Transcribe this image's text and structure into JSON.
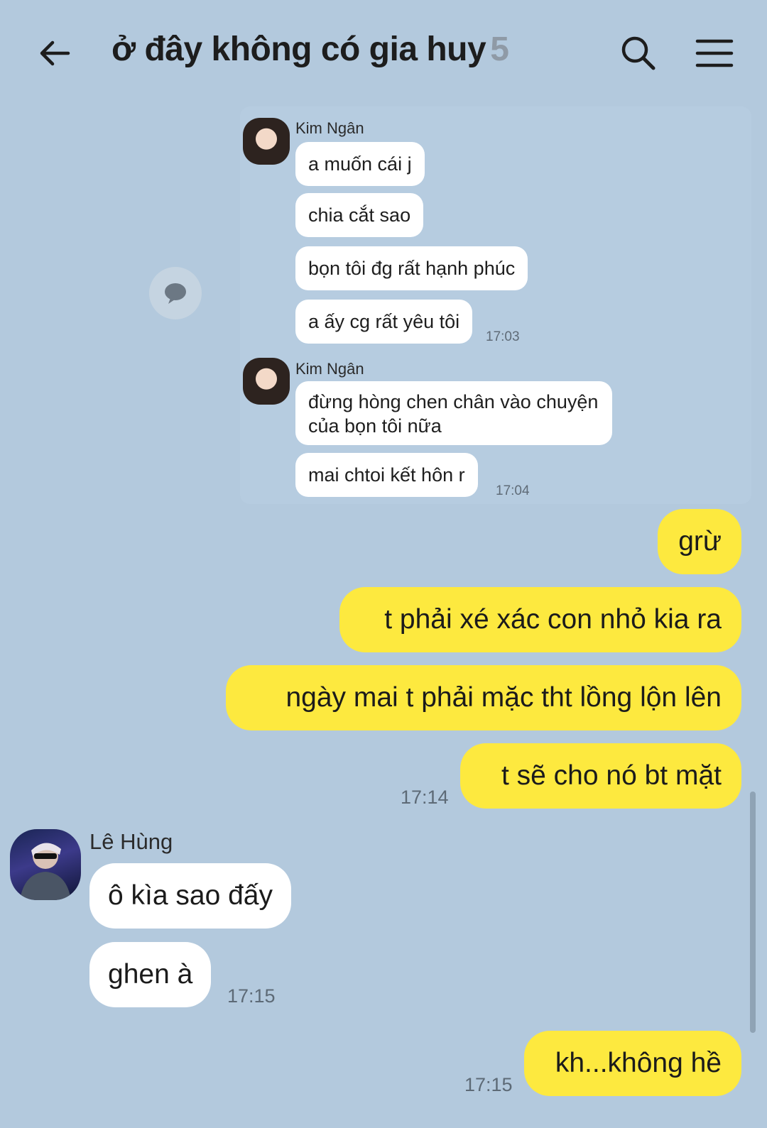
{
  "header": {
    "title": "ở đây không có gia huy",
    "member_count": "5"
  },
  "shared_screenshot": {
    "groups": [
      {
        "sender": "Kim Ngân",
        "messages": [
          "a muốn cái j",
          "chia cắt sao",
          "bọn tôi đg rất hạnh phúc",
          "a ấy cg rất yêu tôi"
        ],
        "time": "17:03"
      },
      {
        "sender": "Kim Ngân",
        "messages": [
          "đừng hòng chen chân vào chuyện của bọn tôi nữa",
          "mai chtoi kết hôn r"
        ],
        "time": "17:04"
      }
    ]
  },
  "my_messages_1": {
    "messages": [
      "grừ",
      "t phải xé xác con nhỏ kia ra",
      "ngày mai t phải mặc tht lồng lộn lên",
      "t sẽ cho nó bt mặt"
    ],
    "time": "17:14"
  },
  "other_messages": {
    "sender": "Lê Hùng",
    "messages": [
      "ô kìa sao đấy",
      "ghen à"
    ],
    "time": "17:15"
  },
  "my_messages_2": {
    "messages": [
      "kh...không hề"
    ],
    "time": "17:15"
  },
  "colors": {
    "background": "#b3c9dd",
    "my_bubble": "#fde93f",
    "other_bubble": "#ffffff"
  }
}
